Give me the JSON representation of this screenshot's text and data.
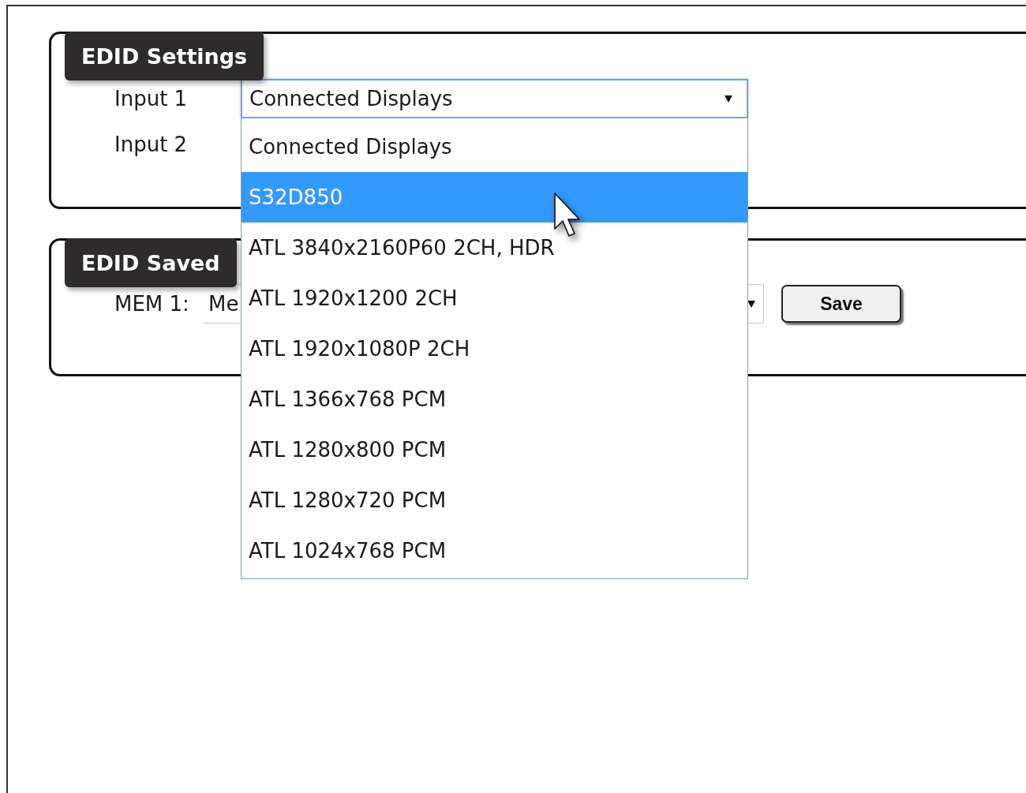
{
  "edid_settings": {
    "title": "EDID Settings",
    "inputs": [
      {
        "label": "Input 1",
        "value": "Connected Displays",
        "expanded": true,
        "options": [
          {
            "label": "Connected Displays",
            "highlighted": false
          },
          {
            "label": "S32D850",
            "highlighted": true
          },
          {
            "label": "ATL 3840x2160P60 2CH, HDR",
            "highlighted": false
          },
          {
            "label": "ATL 1920x1200 2CH",
            "highlighted": false
          },
          {
            "label": "ATL 1920x1080P 2CH",
            "highlighted": false
          },
          {
            "label": "ATL 1366x768 PCM",
            "highlighted": false
          },
          {
            "label": "ATL 1280x800 PCM",
            "highlighted": false
          },
          {
            "label": "ATL 1280x720 PCM",
            "highlighted": false
          },
          {
            "label": "ATL 1024x768 PCM",
            "highlighted": false
          }
        ]
      },
      {
        "label": "Input 2"
      }
    ]
  },
  "edid_saved": {
    "title": "EDID Saved",
    "memories": [
      {
        "label": "MEM 1:",
        "value": "Me",
        "button": "Save"
      }
    ]
  }
}
